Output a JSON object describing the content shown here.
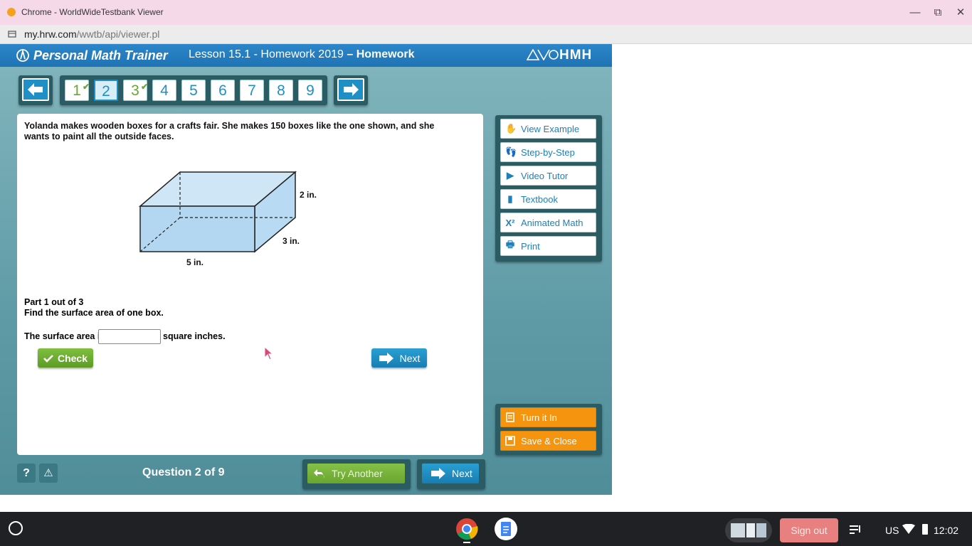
{
  "window": {
    "title": "Chrome - WorldWideTestbank Viewer",
    "minimize_glyph": "—",
    "restore_glyph": "⧉",
    "close_glyph": "✕"
  },
  "address": {
    "host": "my.hrw.com",
    "path": "/wwtb/api/viewer.pl"
  },
  "header": {
    "app_name": "Personal Math Trainer",
    "lesson": "Lesson 15.1 - Homework 2019",
    "lesson_suffix": " – Homework",
    "brand": "HMH",
    "brand_colors": [
      "#2b86c9",
      "#1f73b4"
    ]
  },
  "nav": {
    "questions": [
      {
        "label": "1",
        "done": true
      },
      {
        "label": "2",
        "current": true
      },
      {
        "label": "3",
        "done": true
      },
      {
        "label": "4"
      },
      {
        "label": "5"
      },
      {
        "label": "6"
      },
      {
        "label": "7"
      },
      {
        "label": "8"
      },
      {
        "label": "9"
      }
    ],
    "checkmark": "✔"
  },
  "question": {
    "text": "Yolanda makes wooden boxes for a crafts fair. She makes 150 boxes like the one shown, and she wants to paint all the outside faces.",
    "dims": {
      "height": "2 in.",
      "depth": "3 in.",
      "width": "5 in."
    },
    "part_label": "Part 1 out of 3",
    "part_prompt": "Find the surface area of one box.",
    "answer_pre": "The surface area is",
    "answer_value": "",
    "answer_post": "square inches.",
    "check_label": "Check",
    "next_label": "Next"
  },
  "help": {
    "items": [
      {
        "label": "View Example",
        "icon": "hand-icon",
        "glyph": "✋"
      },
      {
        "label": "Step-by-Step",
        "icon": "footprint-icon",
        "glyph": "👣"
      },
      {
        "label": "Video Tutor",
        "icon": "play-icon",
        "glyph": "▶"
      },
      {
        "label": "Textbook",
        "icon": "book-icon",
        "glyph": "▮"
      },
      {
        "label": "Animated Math",
        "icon": "x-squared-icon",
        "glyph": "X²"
      },
      {
        "label": "Print",
        "icon": "printer-icon",
        "glyph": "🖶"
      }
    ]
  },
  "actions": {
    "turn_in": "Turn it In",
    "save_close": "Save & Close"
  },
  "footer": {
    "help_glyph": "?",
    "warn_glyph": "⚠",
    "question_count": "Question 2 of 9",
    "try_another": "Try Another",
    "next": "Next"
  },
  "taskbar": {
    "sign_out": "Sign out",
    "ime": "US",
    "clock": "12:02"
  }
}
